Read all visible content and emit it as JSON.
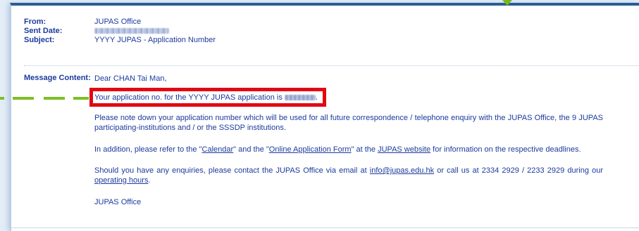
{
  "email": {
    "from_label": "From:",
    "from_value": "JUPAS Office",
    "sent_label": "Sent Date:",
    "subject_label": "Subject:",
    "subject_value": "YYYY JUPAS - Application Number"
  },
  "message": {
    "label": "Message Content:",
    "greeting": "Dear CHAN Tai Man,",
    "app_line_prefix": "Your application no. for the YYYY JUPAS application is",
    "app_line_suffix": ".",
    "para1": "Please note down your application number which will be used for all future correspondence / telephone enquiry with the JUPAS Office, the 9 JUPAS participating-institutions and / or the SSSDP institutions.",
    "para2": {
      "t1": "In addition, please refer to the \"",
      "link_calendar": "Calendar",
      "t2": "\" and the \"",
      "link_form": "Online Application Form",
      "t3": "\" at the ",
      "link_website": "JUPAS website",
      "t4": " for information on the respective deadlines."
    },
    "para3": {
      "t1": "Should you have any enquiries, please contact the JUPAS Office via email at ",
      "link_email": "info@jupas.edu.hk",
      "t2": " or call us at 2334 2929 / 2233 2929 during our ",
      "link_hours": "operating hours",
      "t3": "."
    },
    "signature": "JUPAS Office"
  },
  "colors": {
    "text": "#1c3a9c",
    "highlight_border": "#e30613",
    "dash": "#7bbf24",
    "top_border": "#2b5d95"
  },
  "icons": {
    "top_arrow": "triangle-down",
    "dashed_arrow": "dashed-pointer"
  }
}
